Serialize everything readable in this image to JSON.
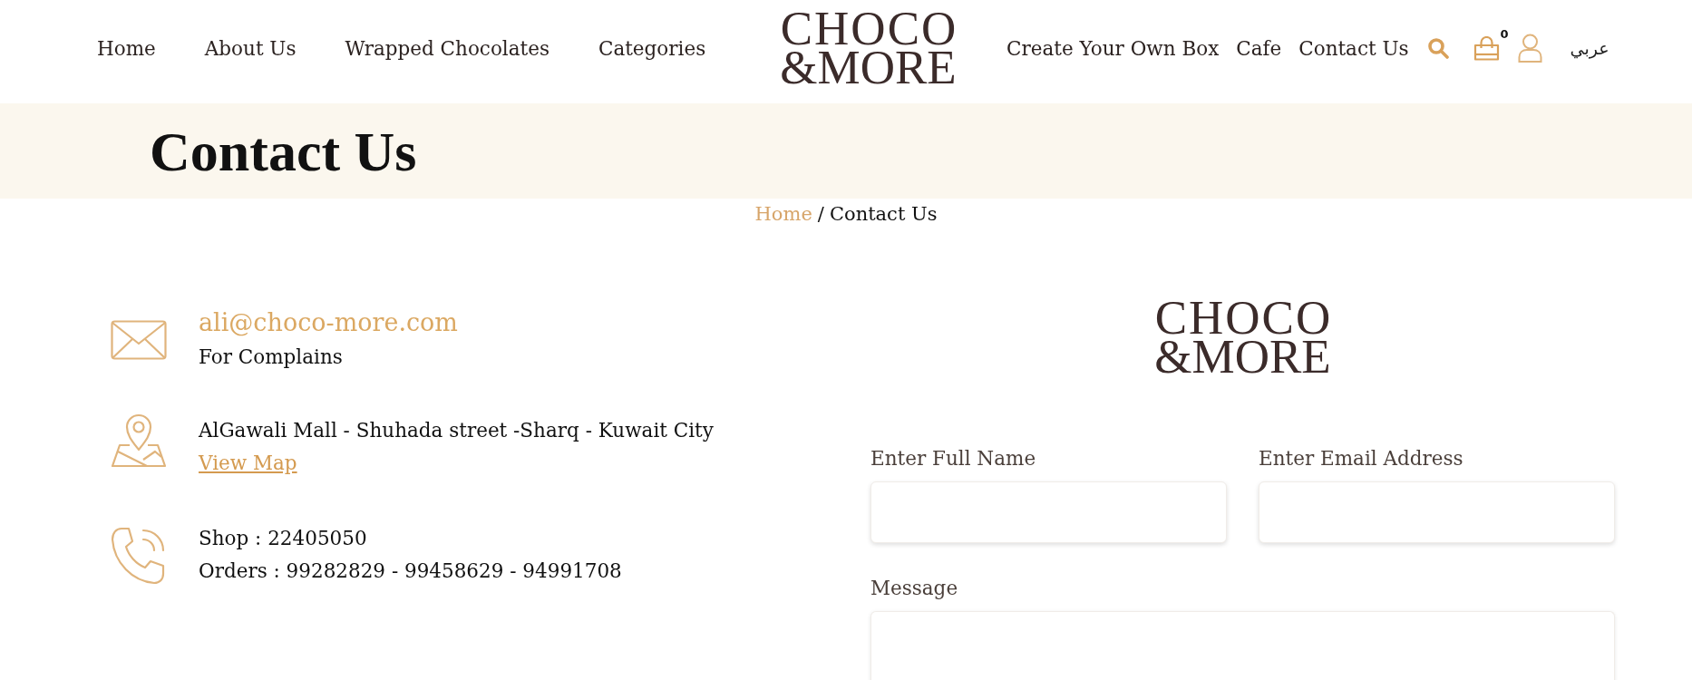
{
  "header": {
    "nav_left": [
      "Home",
      "About Us",
      "Wrapped Chocolates",
      "Categories"
    ],
    "logo": {
      "line1": "CHOCO",
      "line2": "&MORE"
    },
    "nav_right": [
      "Create Your Own Box",
      "Cafe",
      "Contact Us"
    ],
    "cart_count": "0",
    "language": "عربي"
  },
  "page_title": "Contact Us",
  "breadcrumb": {
    "items": [
      {
        "label": "Home",
        "kind": "link"
      },
      {
        "label": "Contact Us",
        "kind": "current"
      }
    ],
    "separator": "/"
  },
  "contacts": [
    {
      "kind": "email",
      "title": "ali@choco-more.com",
      "lines": [
        "For Complains"
      ]
    },
    {
      "kind": "address",
      "lines": [
        "AlGawali Mall - Shuhada street -Sharq - Kuwait City"
      ],
      "link": "View Map"
    },
    {
      "kind": "phone",
      "lines": [
        "Shop : 22405050",
        "Orders : 99282829 - 99458629 - 94991708"
      ]
    }
  ],
  "form": {
    "logo": {
      "line1": "CHOCO",
      "line2": "&MORE"
    },
    "fields": [
      {
        "label": "Enter Full Name",
        "kind": "input"
      },
      {
        "label": "Enter Email Address",
        "kind": "input"
      },
      {
        "label": "Message",
        "kind": "textarea"
      }
    ]
  }
}
